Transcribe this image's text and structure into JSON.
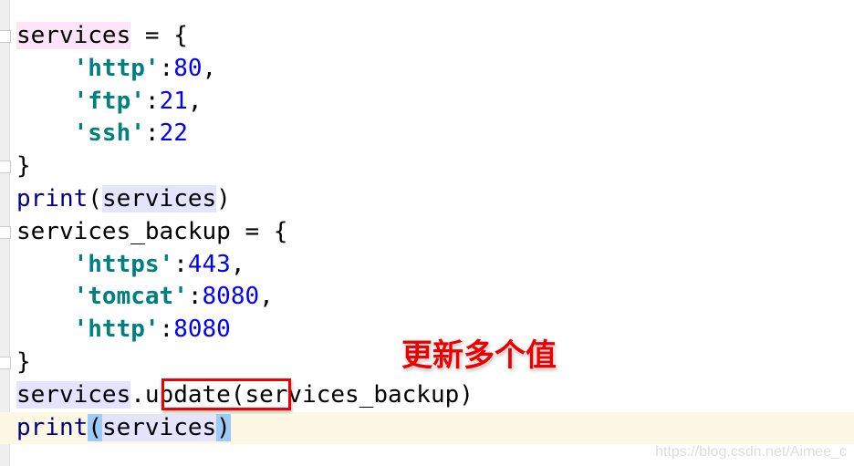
{
  "editor": {
    "lines": [
      [
        {
          "t": "services",
          "c": "hl-pink"
        },
        {
          "t": " = {"
        }
      ],
      [
        {
          "t": "    "
        },
        {
          "t": "'http'",
          "c": "str"
        },
        {
          "t": ":"
        },
        {
          "t": "80",
          "c": "num"
        },
        {
          "t": ","
        }
      ],
      [
        {
          "t": "    "
        },
        {
          "t": "'ftp'",
          "c": "str"
        },
        {
          "t": ":"
        },
        {
          "t": "21",
          "c": "num"
        },
        {
          "t": ","
        }
      ],
      [
        {
          "t": "    "
        },
        {
          "t": "'ssh'",
          "c": "str"
        },
        {
          "t": ":"
        },
        {
          "t": "22",
          "c": "num"
        }
      ],
      [
        {
          "t": "}"
        }
      ],
      [
        {
          "t": "print",
          "c": "kw"
        },
        {
          "t": "("
        },
        {
          "t": "services",
          "c": "hl-purple"
        },
        {
          "t": ")"
        }
      ],
      [
        {
          "t": "services_backup = {"
        }
      ],
      [
        {
          "t": "    "
        },
        {
          "t": "'https'",
          "c": "str"
        },
        {
          "t": ":"
        },
        {
          "t": "443",
          "c": "num"
        },
        {
          "t": ","
        }
      ],
      [
        {
          "t": "    "
        },
        {
          "t": "'tomcat'",
          "c": "str"
        },
        {
          "t": ":"
        },
        {
          "t": "8080",
          "c": "num"
        },
        {
          "t": ","
        }
      ],
      [
        {
          "t": "    "
        },
        {
          "t": "'http'",
          "c": "str"
        },
        {
          "t": ":"
        },
        {
          "t": "8080",
          "c": "num"
        }
      ],
      [
        {
          "t": "}"
        }
      ],
      [
        {
          "t": "services",
          "c": "hl-purple"
        },
        {
          "t": ".update(services_backup)"
        }
      ],
      [
        {
          "t": "print",
          "c": "kw"
        },
        {
          "t": "(",
          "c": "hl-blue"
        },
        {
          "t": "services",
          "c": "hl-purple"
        },
        {
          "t": ")",
          "c": "hl-blue"
        }
      ]
    ],
    "current_line": 12
  },
  "annotation": {
    "text": "更新多个值",
    "color": "#ee0000"
  },
  "watermark": "https://blog.csdn.net/Aimee_c"
}
